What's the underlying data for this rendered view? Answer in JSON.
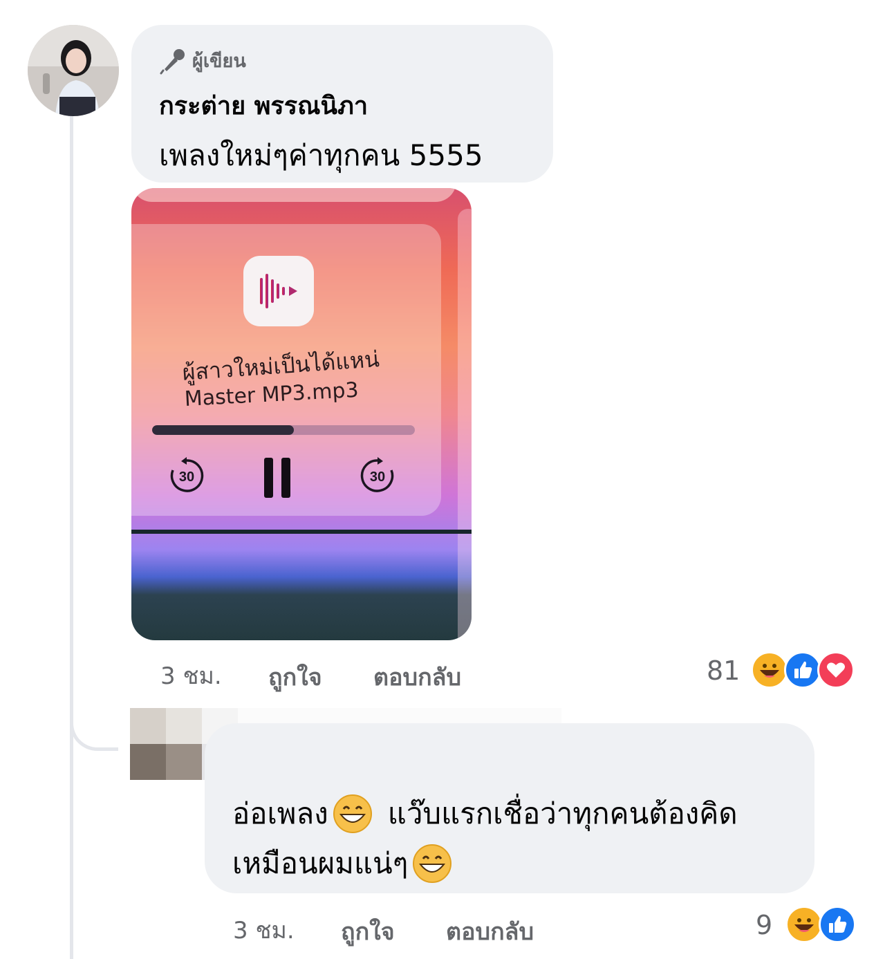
{
  "comment": {
    "badge_label": "ผู้เขียน",
    "author": "กระต่าย พรรณนิภา",
    "text": "เพลงใหม่ๆค่าทุกคน 5555",
    "time": "3 ชม.",
    "like_label": "ถูกใจ",
    "reply_label": "ตอบกลับ",
    "reaction_count": "81",
    "reactions": [
      "haha-icon",
      "like-icon",
      "love-icon"
    ],
    "photo": {
      "track_title_line1": "ผู้สาวใหม่เป็นได้แหน่",
      "track_title_line2": "Master MP3.mp3",
      "progress": 0.54,
      "skip_back_seconds": "30",
      "skip_forward_seconds": "30"
    }
  },
  "reply": {
    "text_line1_part1": "อ่อเพลง",
    "text_line1_part2": "แว๊บแรกเชื่อว่าทุกคนต้องคิด",
    "text_line2": "เหมือนผมแน่ๆ",
    "time": "3 ชม.",
    "like_label": "ถูกใจ",
    "reply_label": "ตอบกลับ",
    "reaction_count": "9",
    "reactions": [
      "haha-icon",
      "like-icon"
    ]
  },
  "colors": {
    "bubble": "#eff1f4",
    "meta_text": "#65676b",
    "like_blue": "#1877f2",
    "love_red": "#f33e58",
    "haha_yellow": "#f7b125"
  }
}
